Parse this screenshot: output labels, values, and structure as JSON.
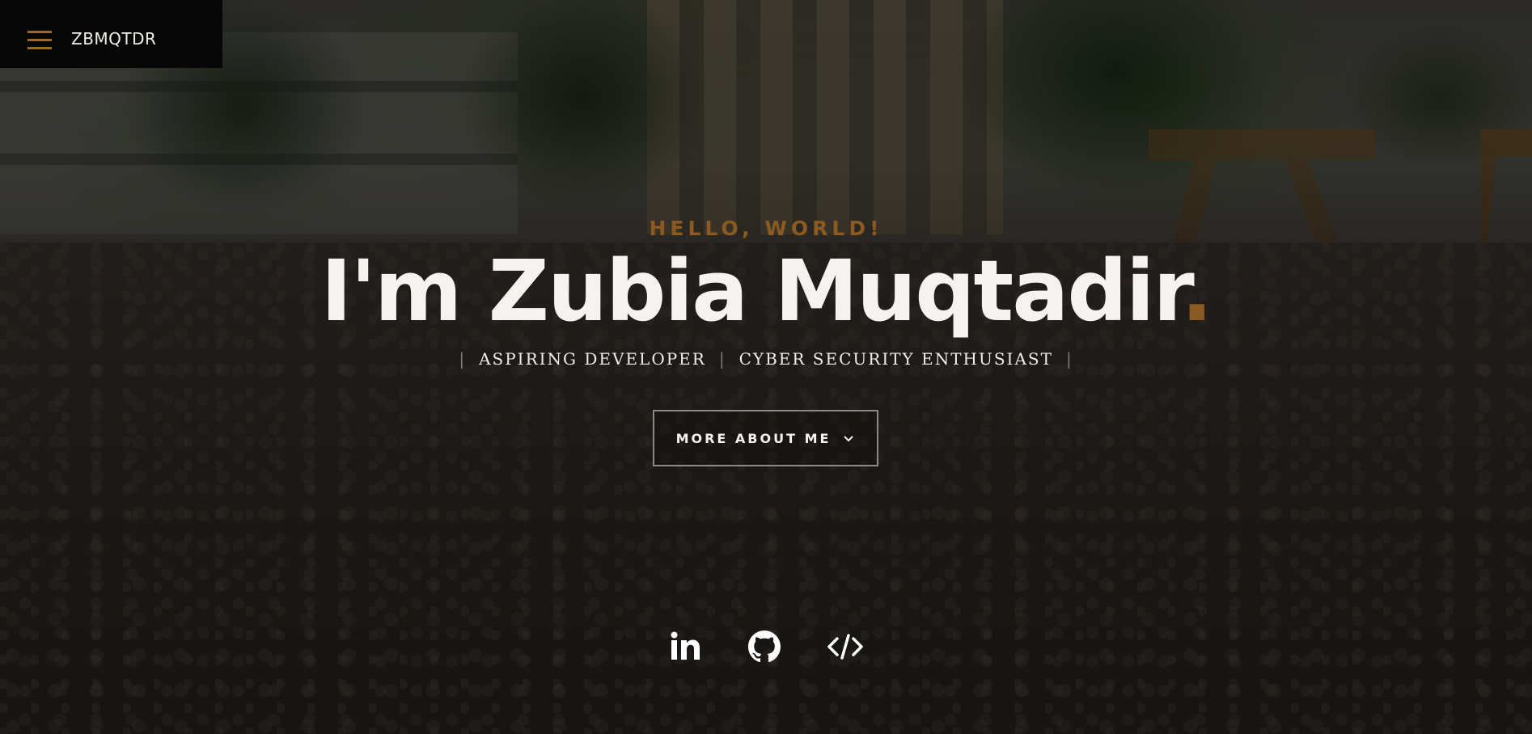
{
  "header": {
    "logo_text": "ZBMQTDR",
    "menu_icon": "hamburger-menu-icon"
  },
  "hero": {
    "intro": "HELLO, WORLD!",
    "headline_main": "I'm Zubia Muqtadir",
    "headline_end": ".",
    "roles": [
      "ASPIRING DEVELOPER",
      "CYBER SECURITY ENTHUSIAST"
    ],
    "role_separator": "|",
    "cta_label": "MORE ABOUT ME",
    "cta_icon": "chevron-down-icon"
  },
  "social": [
    {
      "name": "linkedin",
      "icon": "linkedin-icon"
    },
    {
      "name": "github",
      "icon": "github-icon"
    },
    {
      "name": "code",
      "icon": "code-icon"
    }
  ],
  "colors": {
    "accent": "#8a5a22",
    "header_bg": "#070707",
    "text": "#f4f3f1"
  }
}
